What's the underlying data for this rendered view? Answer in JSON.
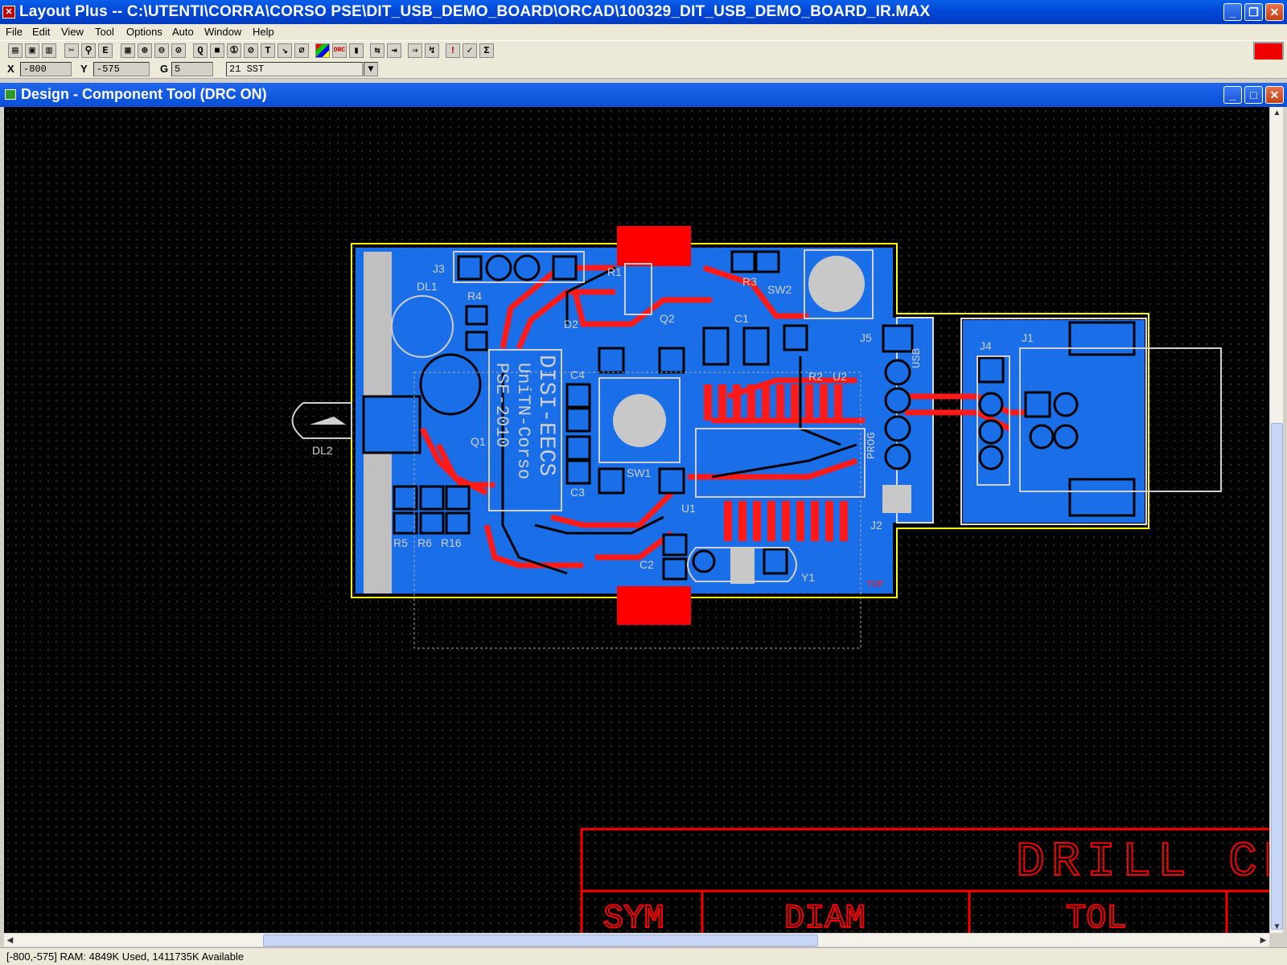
{
  "app": {
    "title": "Layout Plus -- C:\\UTENTI\\CORRA\\CORSO PSE\\DIT_USB_DEMO_BOARD\\ORCAD\\100329_DIT_USB_DEMO_BOARD_IR.MAX"
  },
  "menu": [
    "File",
    "Edit",
    "View",
    "Tool",
    "Options",
    "Auto",
    "Window",
    "Help"
  ],
  "coords": {
    "x_label": "X",
    "x_value": "-800",
    "y_label": "Y",
    "y_value": "-575",
    "g_label": "G",
    "g_value": "5",
    "layer_value": "21 SST"
  },
  "child": {
    "title": "Design - Component Tool (DRC ON)"
  },
  "board": {
    "silk_text": [
      "DISI-EECS",
      "UniTN-Corso",
      "PSE-2010"
    ],
    "usb_label": "USB",
    "prog_label": "PROG",
    "top_label": "TOP",
    "designators": [
      "J3",
      "R1",
      "R3",
      "SW2",
      "DL1",
      "R4",
      "D2",
      "Q2",
      "C1",
      "J5",
      "C4",
      "Q1",
      "SW1",
      "C3",
      "U1",
      "R5",
      "R6",
      "R16",
      "C2",
      "Y1",
      "DL2",
      "J2",
      "J4",
      "J1",
      "R2",
      "U2"
    ],
    "drill_chart": {
      "title": "DRILL CHA",
      "col_headers": [
        "SYM",
        "DIAM",
        "TOL"
      ]
    }
  },
  "status": {
    "text": "[-800,-575]   RAM: 4849K Used, 1411735K Available"
  },
  "colors": {
    "copper_top": "#ff0000",
    "copper_bottom": "#0066ff",
    "silkscreen": "#c8c8c8",
    "board_outline": "#ffff00"
  }
}
